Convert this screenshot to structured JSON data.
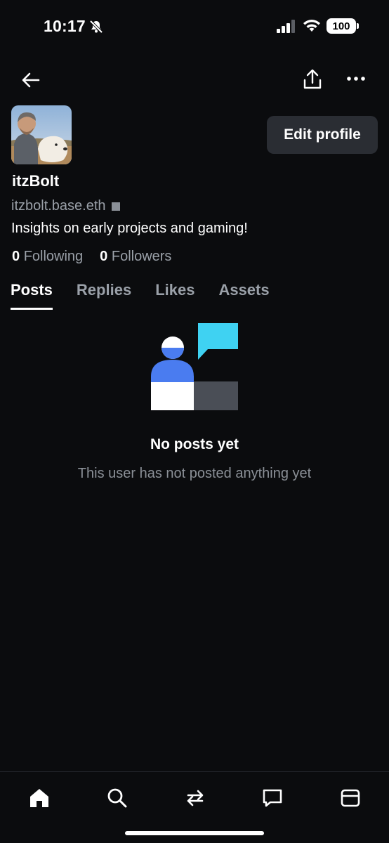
{
  "status": {
    "time": "10:17",
    "battery": "100"
  },
  "header": {
    "back_icon": "back-arrow-icon",
    "share_icon": "share-icon",
    "more_icon": "more-icon"
  },
  "profile": {
    "edit_label": "Edit profile",
    "username": "itzBolt",
    "handle": "itzbolt.base.eth",
    "bio": "Insights on early projects and gaming!",
    "following_count": "0",
    "following_label": "Following",
    "followers_count": "0",
    "followers_label": "Followers"
  },
  "tabs": [
    {
      "label": "Posts"
    },
    {
      "label": "Replies"
    },
    {
      "label": "Likes"
    },
    {
      "label": "Assets"
    }
  ],
  "empty": {
    "title": "No posts yet",
    "subtitle": "This user has not posted anything yet"
  },
  "nav": [
    "home-icon",
    "search-icon",
    "swap-icon",
    "messages-icon",
    "wallet-icon"
  ],
  "colors": {
    "accent_blue": "#4a7cf0",
    "accent_cyan": "#3fd2f2",
    "background": "#0b0c0e"
  }
}
